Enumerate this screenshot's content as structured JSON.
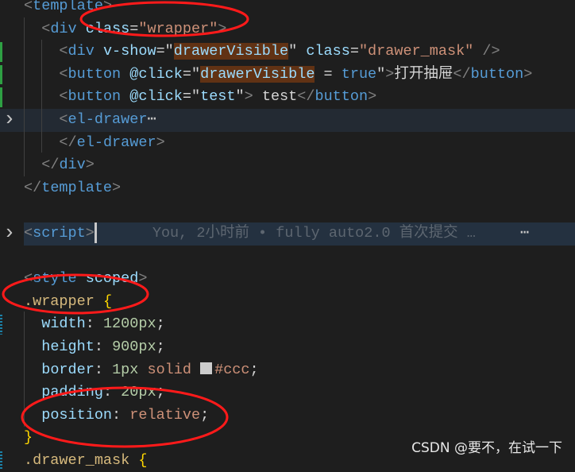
{
  "editor": {
    "lines": [
      {
        "tokens": [
          {
            "t": "<",
            "k": "bracket"
          },
          {
            "t": "template",
            "k": "tag"
          },
          {
            "t": ">",
            "k": "bracket"
          }
        ]
      },
      {
        "tokens": [
          {
            "t": "  "
          },
          {
            "t": "<",
            "k": "bracket"
          },
          {
            "t": "div",
            "k": "tag"
          },
          {
            "t": " class",
            "k": "attr"
          },
          {
            "t": "=",
            "k": "txt"
          },
          {
            "t": "\"wrapper\"",
            "k": "str"
          },
          {
            "t": ">",
            "k": "bracket"
          }
        ]
      },
      {
        "gutter": "green",
        "tokens": [
          {
            "t": "    "
          },
          {
            "t": "<",
            "k": "bracket"
          },
          {
            "t": "div",
            "k": "tag"
          },
          {
            "t": " v-show",
            "k": "attr"
          },
          {
            "t": "=\"",
            "k": "txt"
          },
          {
            "t": "drawerVisible",
            "k": "attr hl"
          },
          {
            "t": "\"",
            "k": "txt"
          },
          {
            "t": " class",
            "k": "attr"
          },
          {
            "t": "=",
            "k": "txt"
          },
          {
            "t": "\"drawer_mask\"",
            "k": "str"
          },
          {
            "t": " />",
            "k": "bracket"
          }
        ]
      },
      {
        "gutter": "green",
        "tokens": [
          {
            "t": "    "
          },
          {
            "t": "<",
            "k": "bracket"
          },
          {
            "t": "button",
            "k": "tag"
          },
          {
            "t": " @click",
            "k": "attr"
          },
          {
            "t": "=\"",
            "k": "txt"
          },
          {
            "t": "drawerVisible",
            "k": "attr hl"
          },
          {
            "t": " = ",
            "k": "txt"
          },
          {
            "t": "true",
            "k": "tag"
          },
          {
            "t": "\"",
            "k": "txt"
          },
          {
            "t": ">",
            "k": "bracket"
          },
          {
            "t": "打开抽屉",
            "k": "txt"
          },
          {
            "t": "</",
            "k": "bracket"
          },
          {
            "t": "button",
            "k": "tag"
          },
          {
            "t": ">",
            "k": "bracket"
          }
        ]
      },
      {
        "gutter": "green",
        "tokens": [
          {
            "t": "    "
          },
          {
            "t": "<",
            "k": "bracket"
          },
          {
            "t": "button",
            "k": "tag"
          },
          {
            "t": " @click",
            "k": "attr"
          },
          {
            "t": "=\"",
            "k": "txt"
          },
          {
            "t": "test",
            "k": "attr"
          },
          {
            "t": "\"",
            "k": "txt"
          },
          {
            "t": ">",
            "k": "bracket"
          },
          {
            "t": " test",
            "k": "txt"
          },
          {
            "t": "</",
            "k": "bracket"
          },
          {
            "t": "button",
            "k": "tag"
          },
          {
            "t": ">",
            "k": "bracket"
          }
        ]
      },
      {
        "fold": true,
        "current": true,
        "tokens": [
          {
            "t": "    "
          },
          {
            "t": "<",
            "k": "bracket"
          },
          {
            "t": "el-drawer",
            "k": "tag"
          },
          {
            "t": "⋯",
            "k": "ellip"
          }
        ]
      },
      {
        "tokens": [
          {
            "t": "    "
          },
          {
            "t": "</",
            "k": "bracket"
          },
          {
            "t": "el-drawer",
            "k": "tag"
          },
          {
            "t": ">",
            "k": "bracket"
          }
        ]
      },
      {
        "tokens": [
          {
            "t": "  "
          },
          {
            "t": "</",
            "k": "bracket"
          },
          {
            "t": "div",
            "k": "tag"
          },
          {
            "t": ">",
            "k": "bracket"
          }
        ]
      },
      {
        "tokens": [
          {
            "t": "</",
            "k": "bracket"
          },
          {
            "t": "template",
            "k": "tag"
          },
          {
            "t": ">",
            "k": "bracket"
          }
        ]
      },
      {
        "tokens": []
      },
      {
        "fold": true,
        "folded": true,
        "cursor": true,
        "blame": "You, 2小时前 • fully auto2.0 首次提交 …",
        "more": "⋯",
        "tokens": [
          {
            "t": "<",
            "k": "bracket"
          },
          {
            "t": "script",
            "k": "tag"
          },
          {
            "t": ">",
            "k": "bracket"
          }
        ]
      },
      {
        "tokens": []
      },
      {
        "tokens": [
          {
            "t": "<",
            "k": "bracket"
          },
          {
            "t": "style",
            "k": "tag"
          },
          {
            "t": " scoped",
            "k": "attr"
          },
          {
            "t": ">",
            "k": "bracket"
          }
        ]
      },
      {
        "tokens": [
          {
            "t": ".wrapper",
            "k": "sel"
          },
          {
            "t": " "
          },
          {
            "t": "{",
            "k": "brace"
          }
        ]
      },
      {
        "gutter": "blue",
        "tokens": [
          {
            "t": "  "
          },
          {
            "t": "width",
            "k": "prop"
          },
          {
            "t": ": ",
            "k": "txt"
          },
          {
            "t": "1200px",
            "k": "num"
          },
          {
            "t": ";",
            "k": "txt"
          }
        ]
      },
      {
        "tokens": [
          {
            "t": "  "
          },
          {
            "t": "height",
            "k": "prop"
          },
          {
            "t": ": ",
            "k": "txt"
          },
          {
            "t": "900px",
            "k": "num"
          },
          {
            "t": ";",
            "k": "txt"
          }
        ]
      },
      {
        "tokens": [
          {
            "t": "  "
          },
          {
            "t": "border",
            "k": "prop"
          },
          {
            "t": ": ",
            "k": "txt"
          },
          {
            "t": "1px",
            "k": "num"
          },
          {
            "t": " solid ",
            "k": "val"
          },
          {
            "t": "■",
            "k": "swatch"
          },
          {
            "t": "#ccc",
            "k": "val"
          },
          {
            "t": ";",
            "k": "txt"
          }
        ]
      },
      {
        "tokens": [
          {
            "t": "  "
          },
          {
            "t": "padding",
            "k": "prop"
          },
          {
            "t": ": ",
            "k": "txt"
          },
          {
            "t": "20px",
            "k": "num"
          },
          {
            "t": ";",
            "k": "txt"
          }
        ]
      },
      {
        "tokens": [
          {
            "t": "  "
          },
          {
            "t": "position",
            "k": "prop"
          },
          {
            "t": ": ",
            "k": "txt"
          },
          {
            "t": "relative",
            "k": "val"
          },
          {
            "t": ";",
            "k": "txt"
          }
        ]
      },
      {
        "tokens": [
          {
            "t": "}",
            "k": "brace"
          }
        ]
      },
      {
        "gutter": "blue",
        "tokens": [
          {
            "t": ".drawer_mask",
            "k": "sel"
          },
          {
            "t": " "
          },
          {
            "t": "{",
            "k": "brace"
          }
        ]
      }
    ]
  },
  "watermark": "CSDN @要不，在试一下",
  "colors": {
    "annotation_ellipse": "#ff1a1a",
    "background": "#1e1e1e",
    "swatch": "#cccccc"
  }
}
